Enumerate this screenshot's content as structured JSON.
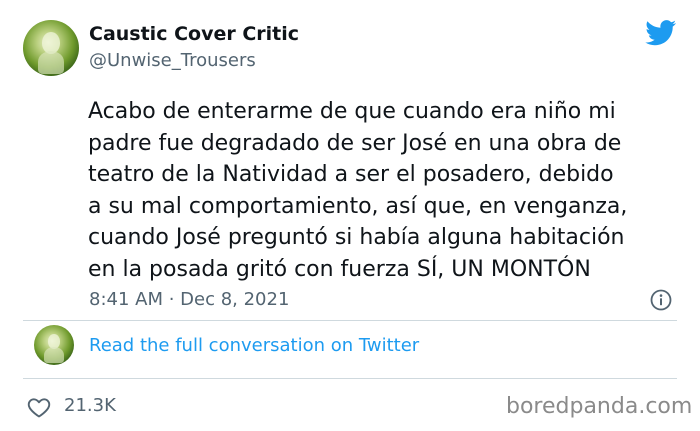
{
  "author": {
    "display_name": "Caustic Cover Critic",
    "handle": "@Unwise_Trousers"
  },
  "tweet": {
    "lines": [
      "Acabo de enterarme de que cuando era niño mi",
      "padre fue degradado de ser José en una obra de",
      "teatro de la Natividad a ser el posadero, debido",
      "a su mal comportamiento, así que, en venganza,",
      "cuando José preguntó si había alguna habitación",
      "en la posada gritó con fuerza SÍ, UN MONTÓN"
    ],
    "timestamp": "8:41 AM · Dec 8, 2021"
  },
  "conversation": {
    "link_label": "Read the full conversation on Twitter"
  },
  "engagement": {
    "likes": "21.3K"
  },
  "watermark": "boredpanda.com",
  "icons": {
    "brand": "twitter-bird-icon",
    "info": "info-icon",
    "like": "heart-icon"
  },
  "colors": {
    "twitter_blue": "#1d9bf0",
    "secondary_text": "#536471",
    "primary_text": "#0f1419",
    "divider": "#cfd9de"
  }
}
